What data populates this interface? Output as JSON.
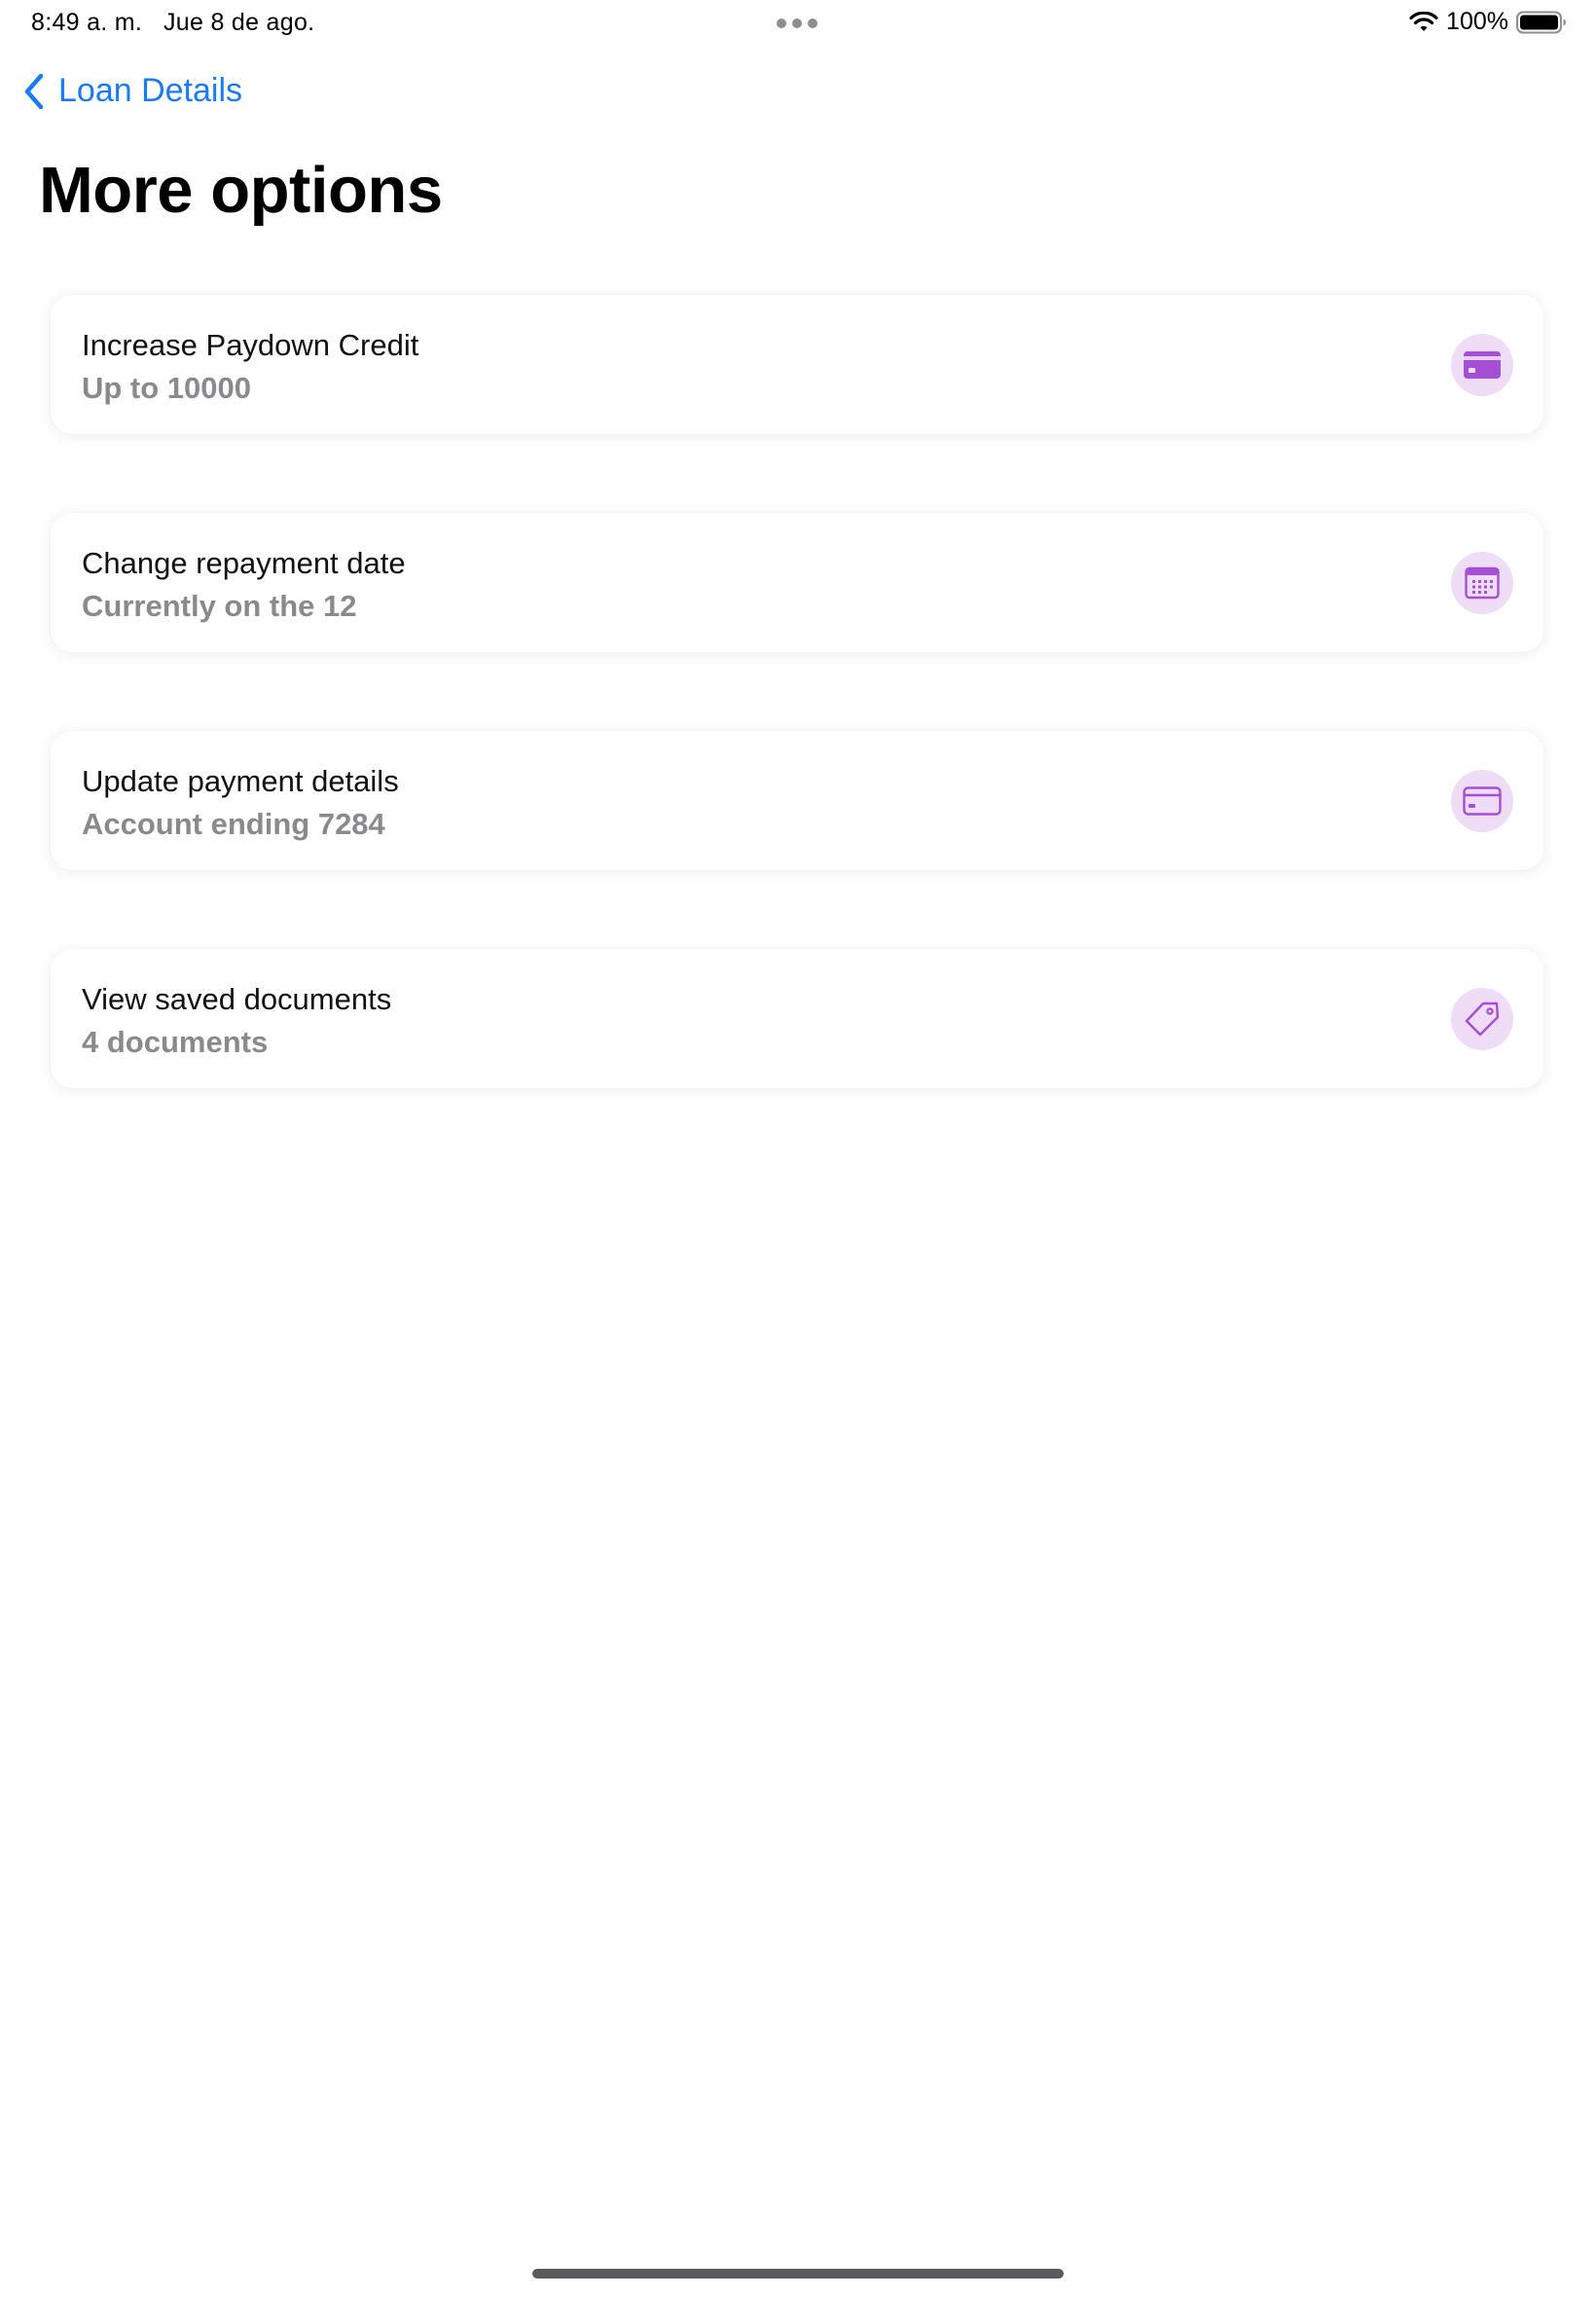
{
  "status_bar": {
    "time": "8:49 a. m.",
    "date": "Jue 8 de ago.",
    "battery": "100%"
  },
  "nav": {
    "back_label": "Loan Details"
  },
  "page": {
    "title": "More options"
  },
  "options": [
    {
      "title": "Increase Paydown Credit",
      "subtitle": "Up to 10000",
      "icon": "credit-card-filled-icon"
    },
    {
      "title": "Change repayment date",
      "subtitle": "Currently on the 12",
      "icon": "calendar-icon"
    },
    {
      "title": "Update payment details",
      "subtitle": "Account ending 7284",
      "icon": "credit-card-outline-icon"
    },
    {
      "title": "View saved documents",
      "subtitle": "4 documents",
      "icon": "tag-icon"
    }
  ],
  "colors": {
    "accent": "#1a7cf5",
    "icon_purple": "#a54fd6",
    "icon_bg": "#efdcf6",
    "subtitle_gray": "#8a8a8e"
  }
}
